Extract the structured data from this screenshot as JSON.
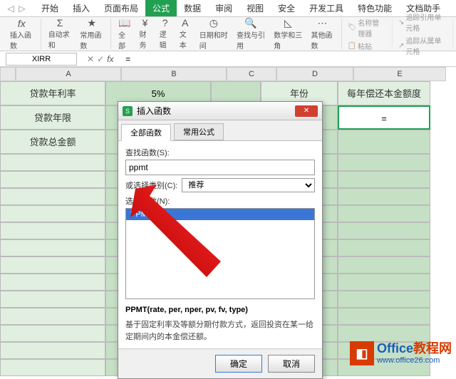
{
  "menu": {
    "tabs": [
      "开始",
      "插入",
      "页面布局",
      "公式",
      "数据",
      "审阅",
      "视图",
      "安全",
      "开发工具",
      "特色功能",
      "文档助手"
    ],
    "active_index": 3
  },
  "ribbon": {
    "fx_label": "fx",
    "insert_fn": "插入函数",
    "autosum": "自动求和",
    "common": "常用函数",
    "all": "全部",
    "financial": "财务",
    "logical": "逻辑",
    "text": "文本",
    "datetime": "日期和时间",
    "lookup": "查找与引用",
    "math": "数学和三角",
    "other": "其他函数",
    "name_mgr": "名称管理器",
    "paste": "粘贴",
    "trace_precedent": "追踪引用单元格",
    "trace_dependent": "追踪从属单元格"
  },
  "formula_bar": {
    "name_box": "XIRR",
    "formula": "="
  },
  "columns": [
    "A",
    "B",
    "C",
    "D",
    "E"
  ],
  "sheet": {
    "r1": {
      "A": "贷款年利率",
      "B": "5%",
      "D": "年份",
      "E": "每年偿还本金额度"
    },
    "r2": {
      "A": "贷款年限",
      "E": "="
    },
    "r3": {
      "A": "贷款总金额"
    }
  },
  "dialog": {
    "title": "插入函数",
    "tabs": [
      "全部函数",
      "常用公式"
    ],
    "search_label": "查找函数(S):",
    "search_value": "ppmt",
    "category_label": "或选择类别(C):",
    "category_value": "推荐",
    "select_label": "选择函数(N):",
    "list_item": "PPMT",
    "signature": "PPMT(rate, per, nper, pv, fv, type)",
    "description": "基于固定利率及等额分期付款方式，返回投资在某一给定期间内的本金偿还额。",
    "ok": "确定",
    "cancel": "取消"
  },
  "watermark": {
    "brand1": "Office",
    "brand2": "教程网",
    "url": "www.office26.com"
  }
}
